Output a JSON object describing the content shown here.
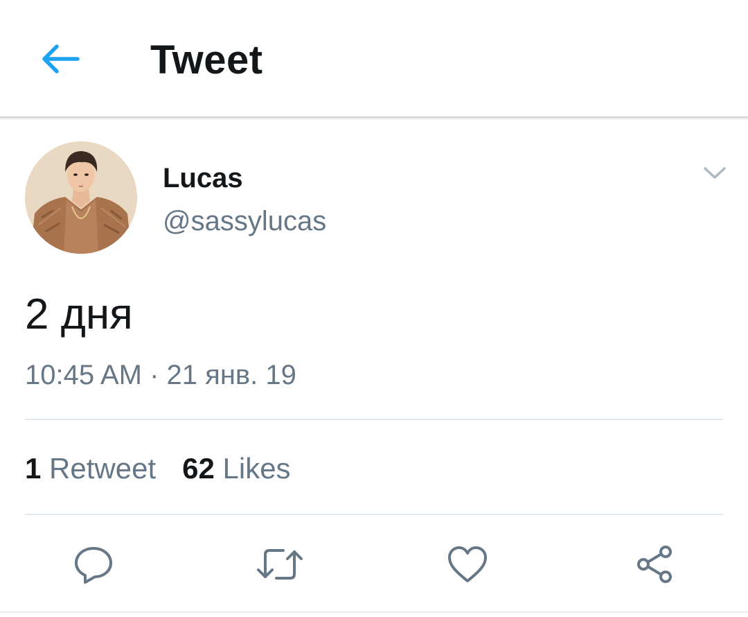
{
  "header": {
    "back_icon": "back-arrow-icon",
    "title": "Tweet"
  },
  "tweet": {
    "author": {
      "name": "Lucas",
      "handle": "@sassylucas",
      "avatar": "avatar-photo"
    },
    "text": "2 дня",
    "timestamp": "10:45 AM · 21 янв. 19",
    "stats": {
      "retweets_count": "1",
      "retweets_label": "Retweet",
      "likes_count": "62",
      "likes_label": "Likes"
    },
    "actions": [
      {
        "icon": "reply-icon"
      },
      {
        "icon": "retweet-icon"
      },
      {
        "icon": "like-heart-icon"
      },
      {
        "icon": "share-icon"
      }
    ]
  },
  "colors": {
    "accent": "#1da1f2",
    "primary_text": "#14171a",
    "secondary_text": "#657786",
    "divider": "#e1e8ed"
  }
}
